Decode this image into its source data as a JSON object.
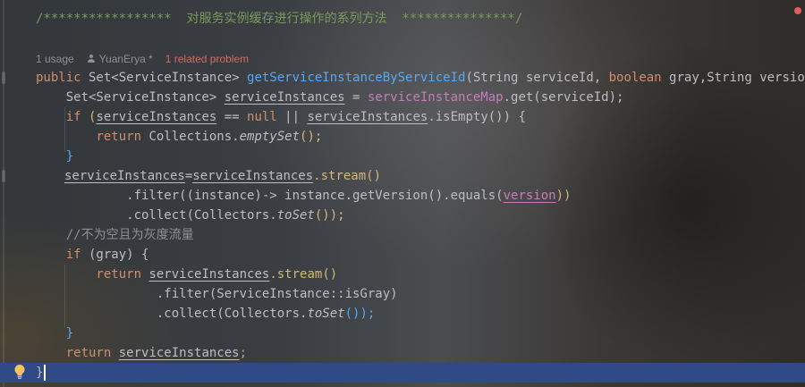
{
  "editor": {
    "comment_header": "/*****************  对服务实例缓存进行操作的系列方法  ***************/",
    "usage_count": "1 usage",
    "author": "YuanErya *",
    "problem_text": "1 related problem",
    "lines": {
      "l1": {
        "kw_public": "public",
        "type_set": " Set<ServiceInstance> ",
        "method_name": "getServiceInstanceByServiceId",
        "params_a": "(String serviceId, ",
        "kw_boolean": "boolean",
        "params_b": " gray,String version) {"
      },
      "l2": {
        "indent_type": "    Set<ServiceInstance> ",
        "var": "serviceInstances",
        "assign": " = ",
        "field": "serviceInstanceMap",
        "call": ".get(serviceId);"
      },
      "l3": {
        "kw_if": "    if",
        "open": " (",
        "var1": "serviceInstances",
        "eq": " == ",
        "kw_null": "null",
        "or": " || ",
        "var2": "serviceInstances",
        "rest": ".isEmpty()) {"
      },
      "l4": {
        "kw_return": "        return",
        "rest_a": " Collections.",
        "italic": "emptySet",
        "rest_b": "();"
      },
      "l5": {
        "text": "    }"
      },
      "l6": {
        "var1": "serviceInstances",
        "eq": "=",
        "var2": "serviceInstances",
        "rest": ".stream()"
      },
      "l7": {
        "rest_a": "            .filter((instance)-> instance.getVersion().equals(",
        "param": "version",
        "rest_b": "))"
      },
      "l8": {
        "rest_a": "            .collect(Collectors.",
        "italic": "toSet",
        "rest_b": "());"
      },
      "l9": {
        "comment": "    //不为空且为灰度流量"
      },
      "l10": {
        "kw_if": "    if",
        "rest": " (gray) {"
      },
      "l11": {
        "kw_return": "        return",
        "sp": " ",
        "var": "serviceInstances",
        "rest": ".stream()"
      },
      "l12": {
        "text": "                .filter(ServiceInstance::isGray)"
      },
      "l13": {
        "rest_a": "                .collect(Collectors.",
        "italic": "toSet",
        "rest_b": "());"
      },
      "l14": {
        "text": "    }"
      },
      "l15": {
        "kw_return": "    return",
        "sp": " ",
        "var": "serviceInstances",
        "rest": ";"
      },
      "l16": {
        "text": "}"
      }
    }
  },
  "icons": {
    "bulb": "lightbulb-icon",
    "user": "user-icon"
  },
  "colors": {
    "keyword": "#cf8e6d",
    "method": "#56a8f5",
    "field": "#c77dbb",
    "comment": "#7a9a5a",
    "problem": "#d06b63",
    "current_line": "#2f4a86"
  }
}
